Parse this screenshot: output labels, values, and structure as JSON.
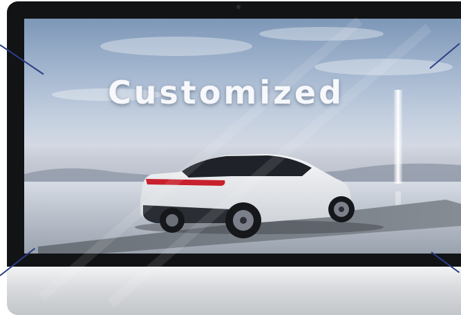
{
  "banner": {
    "headline": "Customized",
    "subject_icon": "suv-car-icon",
    "light_icon": "light-pillar-icon",
    "watermark_icon": "diagonal-watermark-icon"
  },
  "colors": {
    "sky_top": "#7d97b7",
    "horizon": "#d3d8e3",
    "car_body": "#e9ebee",
    "tail_light": "#c8202c",
    "frame": "#121315",
    "callout_lines": "#2b3e86"
  }
}
